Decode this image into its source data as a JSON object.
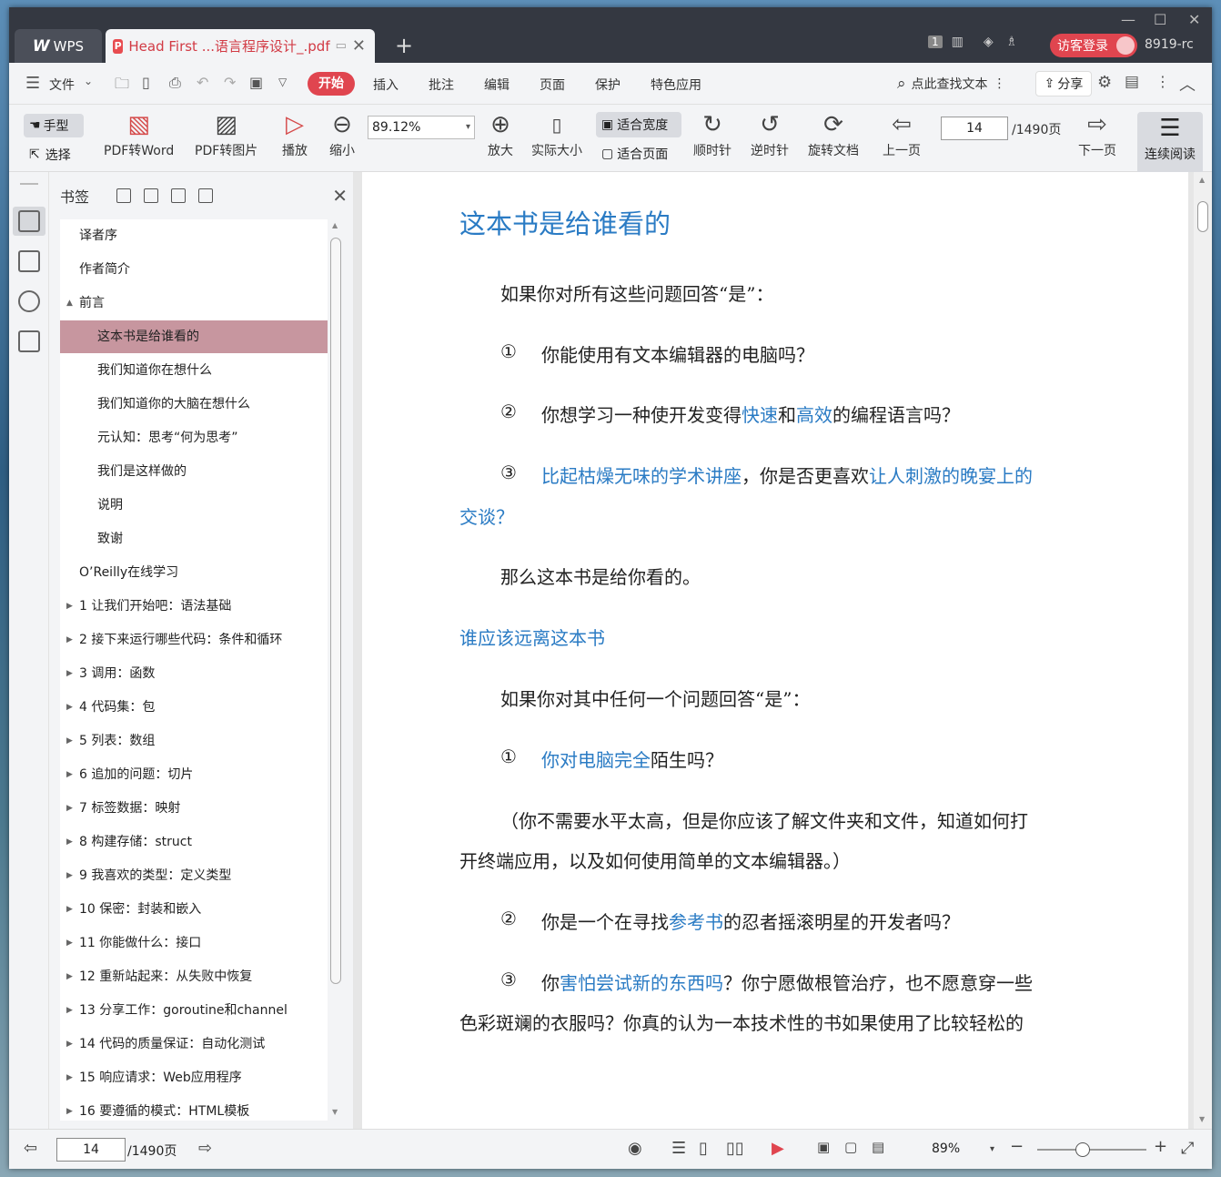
{
  "titlebar": {
    "app_tab": "WPS",
    "doc_tab": "Head First ...语言程序设计_.pdf",
    "badge": "1",
    "login": "访客登录",
    "user": "8919-rc"
  },
  "menu": {
    "file": "文件",
    "tabs": [
      "开始",
      "插入",
      "批注",
      "编辑",
      "页面",
      "保护",
      "特色应用"
    ],
    "search": "点此查找文本",
    "share": "分享"
  },
  "toolbar": {
    "hand": "手型",
    "select": "选择",
    "pdf_word": "PDF转Word",
    "pdf_img": "PDF转图片",
    "play": "播放",
    "zoom_out": "缩小",
    "zoom_value": "89.12%",
    "zoom_in": "放大",
    "actual": "实际大小",
    "fit_width": "适合宽度",
    "fit_page": "适合页面",
    "cw": "顺时针",
    "ccw": "逆时针",
    "rotate": "旋转文档",
    "prev": "上一页",
    "page": "14",
    "total": "/1490页",
    "next": "下一页",
    "continuous": "连续阅读"
  },
  "bookmarks": {
    "title": "书签",
    "items": [
      {
        "label": "译者序",
        "level": 0,
        "toggle": ""
      },
      {
        "label": "作者简介",
        "level": 0,
        "toggle": ""
      },
      {
        "label": "前言",
        "level": 0,
        "toggle": "▲"
      },
      {
        "label": "这本书是给谁看的",
        "level": 1,
        "toggle": ""
      },
      {
        "label": "我们知道你在想什么",
        "level": 1,
        "toggle": ""
      },
      {
        "label": "我们知道你的大脑在想什么",
        "level": 1,
        "toggle": ""
      },
      {
        "label": "元认知：思考“何为思考”",
        "level": 1,
        "toggle": ""
      },
      {
        "label": "我们是这样做的",
        "level": 1,
        "toggle": ""
      },
      {
        "label": "说明",
        "level": 1,
        "toggle": ""
      },
      {
        "label": "致谢",
        "level": 1,
        "toggle": ""
      },
      {
        "label": "O’Reilly在线学习",
        "level": 0,
        "toggle": ""
      },
      {
        "label": "1 让我们开始吧：语法基础",
        "level": 0,
        "toggle": "▶"
      },
      {
        "label": "2 接下来运行哪些代码：条件和循环",
        "level": 0,
        "toggle": "▶"
      },
      {
        "label": "3 调用：函数",
        "level": 0,
        "toggle": "▶"
      },
      {
        "label": "4 代码集：包",
        "level": 0,
        "toggle": "▶"
      },
      {
        "label": "5 列表：数组",
        "level": 0,
        "toggle": "▶"
      },
      {
        "label": "6 追加的问题：切片",
        "level": 0,
        "toggle": "▶"
      },
      {
        "label": "7 标签数据：映射",
        "level": 0,
        "toggle": "▶"
      },
      {
        "label": "8 构建存储：struct",
        "level": 0,
        "toggle": "▶"
      },
      {
        "label": "9 我喜欢的类型：定义类型",
        "level": 0,
        "toggle": "▶"
      },
      {
        "label": "10 保密：封装和嵌入",
        "level": 0,
        "toggle": "▶"
      },
      {
        "label": "11 你能做什么：接口",
        "level": 0,
        "toggle": "▶"
      },
      {
        "label": "12 重新站起来：从失败中恢复",
        "level": 0,
        "toggle": "▶"
      },
      {
        "label": "13 分享工作：goroutine和channel",
        "level": 0,
        "toggle": "▶"
      },
      {
        "label": "14 代码的质量保证：自动化测试",
        "level": 0,
        "toggle": "▶"
      },
      {
        "label": "15 响应请求：Web应用程序",
        "level": 0,
        "toggle": "▶"
      },
      {
        "label": "16 要遵循的模式：HTML模板",
        "level": 0,
        "toggle": "▶"
      }
    ]
  },
  "page": {
    "h1": "这本书是给谁看的",
    "p1": "如果你对所有这些问题回答“是”：",
    "q1_num": "①",
    "q1": "你能使用有文本编辑器的电脑吗？",
    "q2_num": "②",
    "q2_a": "你想学习一种使开发变得",
    "q2_b": "快速",
    "q2_c": "和",
    "q2_d": "高效",
    "q2_e": "的编程语言吗？",
    "q3_num": "③",
    "q3_a": "比起枯燥无味的学术讲座",
    "q3_b": "，你是否更喜欢",
    "q3_c": "让人刺激的晚宴上的",
    "q3_d": "交谈？",
    "p2": "那么这本书是给你看的。",
    "h2": "谁应该远离这本书",
    "p3": "如果你对其中任何一个问题回答“是”：",
    "r1_num": "①",
    "r1_a": "你对电脑完全",
    "r1_b": "陌生吗？",
    "r1_note1": "（你不需要水平太高，但是你应该了解文件夹和文件，知道如何打",
    "r1_note2": "开终端应用，以及如何使用简单的文本编辑器。）",
    "r2_num": "②",
    "r2_a": "你是一个在寻找",
    "r2_b": "参考书",
    "r2_c": "的忍者摇滚明星的开发者吗？",
    "r3_num": "③",
    "r3_a": "你",
    "r3_b": "害怕尝试新的东西吗",
    "r3_c": "？你宁愿做根管治疗，也不愿意穿一些",
    "r3_d": "色彩斑斓的衣服吗？你真的认为一本技术性的书如果使用了比较轻松的"
  },
  "status": {
    "page": "14",
    "total": "/1490页",
    "zoom": "89%"
  }
}
